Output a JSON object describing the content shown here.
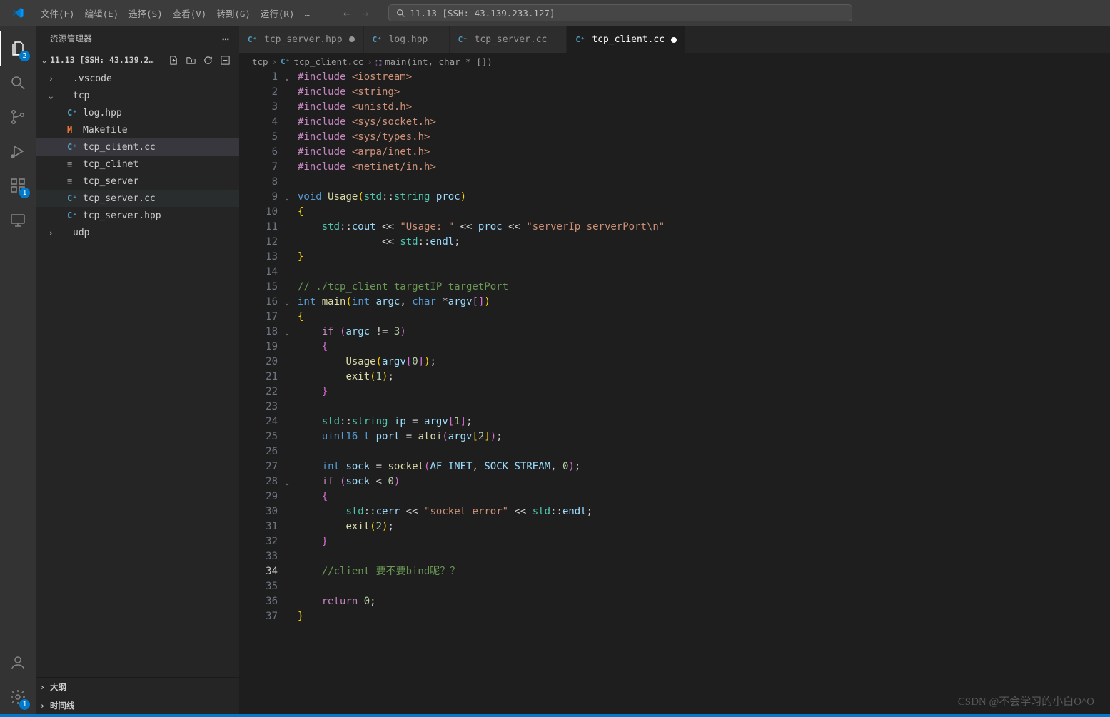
{
  "title_search": "11.13 [SSH: 43.139.233.127]",
  "menu": [
    "文件(F)",
    "编辑(E)",
    "选择(S)",
    "查看(V)",
    "转到(G)",
    "运行(R)",
    "…"
  ],
  "activity_badges": {
    "explorer": "2",
    "ext": "1",
    "gear": "1"
  },
  "sidebar": {
    "title": "资源管理器",
    "section": "11.13 [SSH: 43.139.233.1…",
    "tree": [
      {
        "type": "folder",
        "depth": 1,
        "open": false,
        "label": ".vscode"
      },
      {
        "type": "folder",
        "depth": 1,
        "open": true,
        "label": "tcp"
      },
      {
        "type": "file",
        "depth": 2,
        "icon": "cpp",
        "label": "log.hpp"
      },
      {
        "type": "file",
        "depth": 2,
        "icon": "m",
        "label": "Makefile"
      },
      {
        "type": "file",
        "depth": 2,
        "icon": "cpp",
        "label": "tcp_client.cc",
        "sel": true
      },
      {
        "type": "file",
        "depth": 2,
        "icon": "txt",
        "label": "tcp_clinet"
      },
      {
        "type": "file",
        "depth": 2,
        "icon": "txt",
        "label": "tcp_server"
      },
      {
        "type": "file",
        "depth": 2,
        "icon": "cpp",
        "label": "tcp_server.cc",
        "hov": true
      },
      {
        "type": "file",
        "depth": 2,
        "icon": "cpp",
        "label": "tcp_server.hpp"
      },
      {
        "type": "folder",
        "depth": 1,
        "open": false,
        "label": "udp"
      }
    ],
    "coll1": "大纲",
    "coll2": "时间线"
  },
  "tabs": [
    {
      "icon": "cpp",
      "label": "tcp_server.hpp",
      "dirty": true,
      "active": false
    },
    {
      "icon": "cpp",
      "label": "log.hpp",
      "dirty": false,
      "active": false
    },
    {
      "icon": "cpp",
      "label": "tcp_server.cc",
      "dirty": false,
      "active": false
    },
    {
      "icon": "cpp",
      "label": "tcp_client.cc",
      "dirty": true,
      "active": true
    }
  ],
  "breadcrumbs": [
    "tcp",
    "tcp_client.cc",
    "main(int, char * [])"
  ],
  "code": {
    "current_line": 34,
    "lines": [
      {
        "n": 1,
        "fold": "v",
        "html": "<span class='dir'>#include</span> <span class='str'>&lt;iostream&gt;</span>"
      },
      {
        "n": 2,
        "html": "<span class='dir'>#include</span> <span class='str'>&lt;string&gt;</span>"
      },
      {
        "n": 3,
        "html": "<span class='dir'>#include</span> <span class='str'>&lt;unistd.h&gt;</span>"
      },
      {
        "n": 4,
        "html": "<span class='dir'>#include</span> <span class='str'>&lt;sys/socket.h&gt;</span>"
      },
      {
        "n": 5,
        "html": "<span class='dir'>#include</span> <span class='str'>&lt;sys/types.h&gt;</span>"
      },
      {
        "n": 6,
        "html": "<span class='dir'>#include</span> <span class='str'>&lt;arpa/inet.h&gt;</span>"
      },
      {
        "n": 7,
        "html": "<span class='dir'>#include</span> <span class='str'>&lt;netinet/in.h&gt;</span>"
      },
      {
        "n": 8,
        "html": ""
      },
      {
        "n": 9,
        "fold": "v",
        "html": "<span class='ty'>void</span> <span class='fn'>Usage</span><span class='p1'>(</span><span class='ns'>std</span>::<span class='ns'>string</span> <span class='id'>proc</span><span class='p1'>)</span>"
      },
      {
        "n": 10,
        "html": "<span class='p1'>{</span>"
      },
      {
        "n": 11,
        "html": "    <span class='ns'>std</span>::<span class='id'>cout</span> <span class='op'>&lt;&lt;</span> <span class='str'>\"Usage: \"</span> <span class='op'>&lt;&lt;</span> <span class='id'>proc</span> <span class='op'>&lt;&lt;</span> <span class='str'>\"serverIp serverPort\\n\"</span>"
      },
      {
        "n": 12,
        "html": "              <span class='op'>&lt;&lt;</span> <span class='ns'>std</span>::<span class='id'>endl</span>;"
      },
      {
        "n": 13,
        "html": "<span class='p1'>}</span>"
      },
      {
        "n": 14,
        "html": ""
      },
      {
        "n": 15,
        "html": "<span class='cm'>// ./tcp_client targetIP targetPort</span>"
      },
      {
        "n": 16,
        "fold": "v",
        "html": "<span class='ty'>int</span> <span class='fn'>main</span><span class='p1'>(</span><span class='ty'>int</span> <span class='id'>argc</span>, <span class='ty'>char</span> *<span class='id'>argv</span><span class='p2'>[</span><span class='p2'>]</span><span class='p1'>)</span>"
      },
      {
        "n": 17,
        "html": "<span class='p1'>{</span>"
      },
      {
        "n": 18,
        "fold": "v",
        "html": "    <span class='kw'>if</span> <span class='p2'>(</span><span class='id'>argc</span> != <span class='num'>3</span><span class='p2'>)</span>"
      },
      {
        "n": 19,
        "html": "    <span class='p2'>{</span>"
      },
      {
        "n": 20,
        "html": "        <span class='fn'>Usage</span><span class='p1'>(</span><span class='id'>argv</span><span class='p2'>[</span><span class='num'>0</span><span class='p2'>]</span><span class='p1'>)</span>;"
      },
      {
        "n": 21,
        "html": "        <span class='fn'>exit</span><span class='p1'>(</span><span class='num'>1</span><span class='p1'>)</span>;"
      },
      {
        "n": 22,
        "html": "    <span class='p2'>}</span>"
      },
      {
        "n": 23,
        "html": ""
      },
      {
        "n": 24,
        "html": "    <span class='ns'>std</span>::<span class='ns'>string</span> <span class='id'>ip</span> = <span class='id'>argv</span><span class='p2'>[</span><span class='num'>1</span><span class='p2'>]</span>;"
      },
      {
        "n": 25,
        "html": "    <span class='ty'>uint16_t</span> <span class='id'>port</span> = <span class='fn'>atoi</span><span class='p2'>(</span><span class='id'>argv</span><span class='p1'>[</span><span class='num'>2</span><span class='p1'>]</span><span class='p2'>)</span>;"
      },
      {
        "n": 26,
        "html": ""
      },
      {
        "n": 27,
        "html": "    <span class='ty'>int</span> <span class='id'>sock</span> = <span class='fn'>socket</span><span class='p2'>(</span><span class='id'>AF_INET</span>, <span class='id'>SOCK_STREAM</span>, <span class='num'>0</span><span class='p2'>)</span>;"
      },
      {
        "n": 28,
        "fold": "v",
        "html": "    <span class='kw'>if</span> <span class='p2'>(</span><span class='id'>sock</span> &lt; <span class='num'>0</span><span class='p2'>)</span>"
      },
      {
        "n": 29,
        "html": "    <span class='p2'>{</span>"
      },
      {
        "n": 30,
        "html": "        <span class='ns'>std</span>::<span class='id'>cerr</span> <span class='op'>&lt;&lt;</span> <span class='str'>\"socket error\"</span> <span class='op'>&lt;&lt;</span> <span class='ns'>std</span>::<span class='id'>endl</span>;"
      },
      {
        "n": 31,
        "html": "        <span class='fn'>exit</span><span class='p1'>(</span><span class='num'>2</span><span class='p1'>)</span>;"
      },
      {
        "n": 32,
        "html": "    <span class='p2'>}</span>"
      },
      {
        "n": 33,
        "html": ""
      },
      {
        "n": 34,
        "html": "    <span class='cm'>//client 要不要bind呢？？</span>"
      },
      {
        "n": 35,
        "html": ""
      },
      {
        "n": 36,
        "html": "    <span class='kw'>return</span> <span class='num'>0</span>;"
      },
      {
        "n": 37,
        "html": "<span class='p1'>}</span>"
      }
    ]
  },
  "watermark": "CSDN @不会学习的小白O^O"
}
